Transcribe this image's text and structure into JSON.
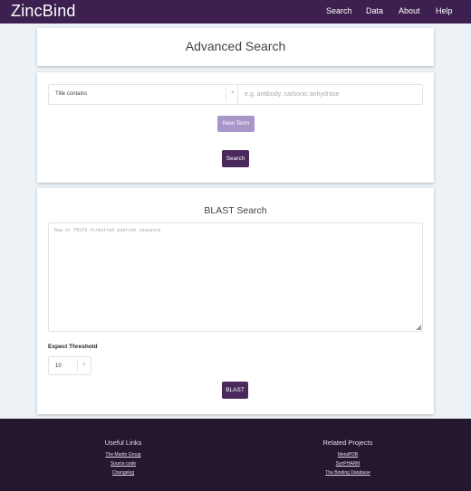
{
  "header": {
    "brand": "ZincBind",
    "nav": [
      "Search",
      "Data",
      "About",
      "Help"
    ]
  },
  "advanced_search": {
    "title": "Advanced Search",
    "field_select": "Title contains",
    "term_placeholder": "e.g. antibody, carbonic anhydrase",
    "new_term_label": "New Term",
    "search_label": "Search"
  },
  "blast": {
    "title": "BLAST Search",
    "sequence_placeholder": "Raw or FASTA formatted peptide sequence",
    "expect_label": "Expect Threshold",
    "expect_value": "10",
    "blast_label": "BLAST"
  },
  "footer": {
    "useful_title": "Useful Links",
    "useful_links": [
      "The Martin Group",
      "Source code",
      "Changelog"
    ],
    "related_title": "Related Projects",
    "related_links": [
      "MetalPDB",
      "SynPHARM",
      "The Binding Database"
    ]
  },
  "colors": {
    "brand": "#3d2050",
    "button": "#4a2a5c",
    "button_light": "#a996c9",
    "footer": "#241730"
  }
}
